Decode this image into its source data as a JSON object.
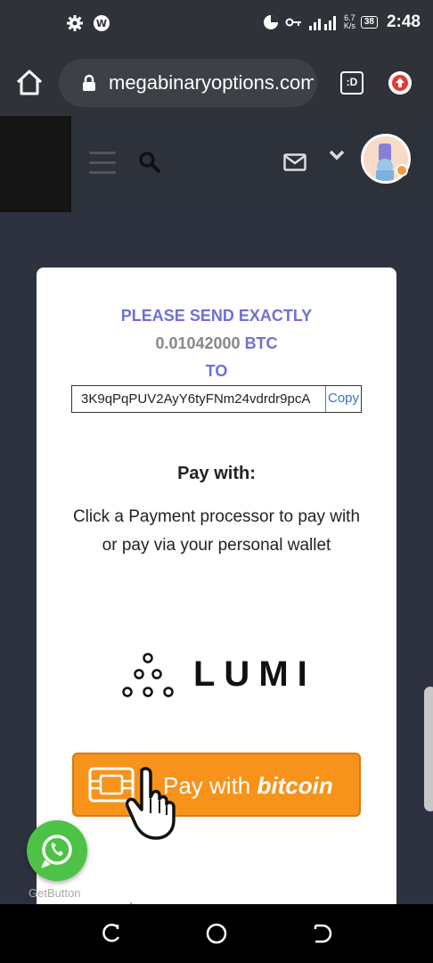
{
  "status_bar": {
    "speed_value": "6.7",
    "speed_unit": "K/s",
    "battery": "38",
    "time": "2:48"
  },
  "browser": {
    "url": "megabinaryoptions.com",
    "tab_label": ":D"
  },
  "site_header": {
    "icons": [
      "menu-icon",
      "search-icon",
      "mail-icon",
      "chevron-down-icon",
      "avatar"
    ]
  },
  "payment": {
    "instruction": "PLEASE SEND EXACTLY",
    "amount": "0.01042000",
    "currency": "BTC",
    "to": "TO",
    "address": "3K9qPqPUV2AyY6tyFNm24vdrdr9pcA",
    "copy_label": "Copy",
    "pay_with_title": "Pay with:",
    "pay_with_description": "Click a Payment processor to pay with or pay via your personal wallet",
    "lumi_label": "LUMI",
    "bitcoin_button_prefix": "Pay with ",
    "bitcoin_button_brand": "bitcoin"
  },
  "widget": {
    "getbutton_label": "GetButton"
  },
  "colors": {
    "accent": "#6f6fd8",
    "bitcoin_orange": "#f7931a",
    "whatsapp_green": "#4dc247",
    "header_bg": "#2d3139",
    "page_bg": "#2d3140"
  }
}
